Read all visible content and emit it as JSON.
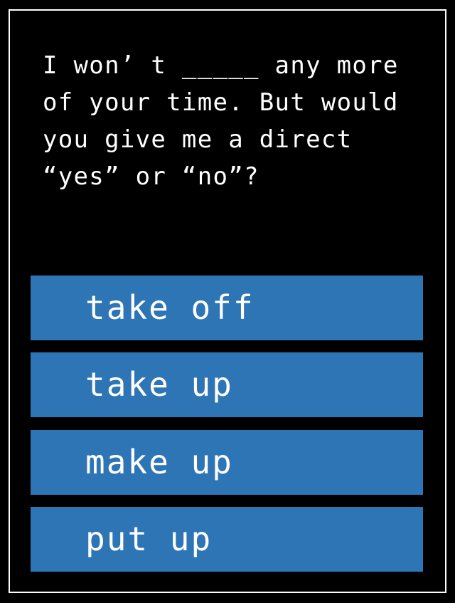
{
  "question": "I won’ t _____ any more\nof your time. But would\nyou give me a direct\n“yes” or “no”?",
  "options": [
    {
      "label": "take off"
    },
    {
      "label": "take up"
    },
    {
      "label": "make up"
    },
    {
      "label": "put up"
    }
  ],
  "colors": {
    "background": "#000000",
    "option_fill": "#2E75B6",
    "text": "#FFFFFF"
  }
}
